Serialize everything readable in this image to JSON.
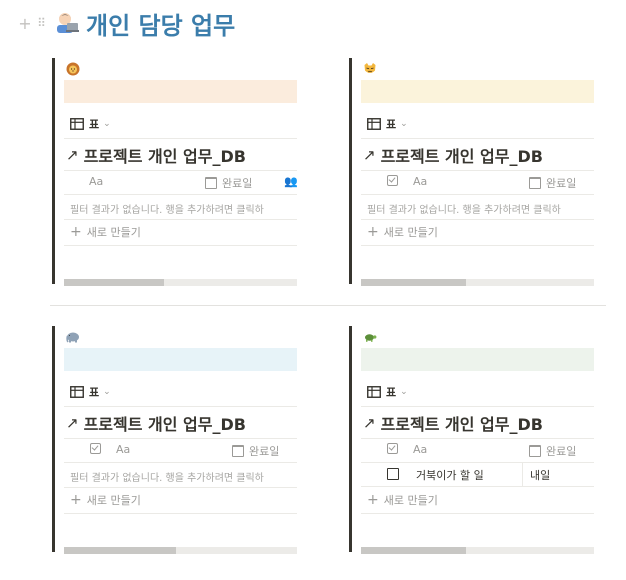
{
  "page": {
    "title": "개인 담당 업무",
    "emoji": "technologist-emoji",
    "handle_plus": "+",
    "handle_drag": "⠿"
  },
  "colors": {
    "title": "#3b7dab",
    "quote_bar": "#37352f",
    "orange_block": "#fbecdd",
    "yellow_block": "#fbf3db",
    "blue_block": "#e7f3f8",
    "green_block": "#edf3ec"
  },
  "sections": [
    {
      "emoji": "lion-emoji",
      "view_label": "표",
      "db_title": "프로젝트 개인 업무_DB",
      "arrow": "↗",
      "columns": {
        "checkbox": "",
        "name": "Aa",
        "date": "완료일"
      },
      "empty_message": "필터 결과가 없습니다. 행을 추가하려면 클릭하",
      "new_label": "새로 만들기",
      "plus": "+"
    },
    {
      "emoji": "cat-emoji",
      "view_label": "표",
      "db_title": "프로젝트 개인 업무_DB",
      "arrow": "↗",
      "columns": {
        "checkbox": "",
        "name": "Aa",
        "date": "완료일"
      },
      "empty_message": "필터 결과가 없습니다. 행을 추가하려면 클릭하",
      "new_label": "새로 만들기",
      "plus": "+"
    },
    {
      "emoji": "elephant-emoji",
      "view_label": "표",
      "db_title": "프로젝트 개인 업무_DB",
      "arrow": "↗",
      "columns": {
        "checkbox": "",
        "name": "Aa",
        "date": "완료일"
      },
      "empty_message": "필터 결과가 없습니다. 행을 추가하려면 클릭하",
      "new_label": "새로 만들기",
      "plus": "+"
    },
    {
      "emoji": "turtle-emoji",
      "view_label": "표",
      "db_title": "프로젝트 개인 업무_DB",
      "arrow": "↗",
      "columns": {
        "checkbox": "",
        "name": "Aa",
        "date": "완료일"
      },
      "rows": [
        {
          "name": "거북이가 할 일",
          "date": "내일",
          "checked": false
        }
      ],
      "new_label": "새로 만들기",
      "plus": "+"
    }
  ]
}
